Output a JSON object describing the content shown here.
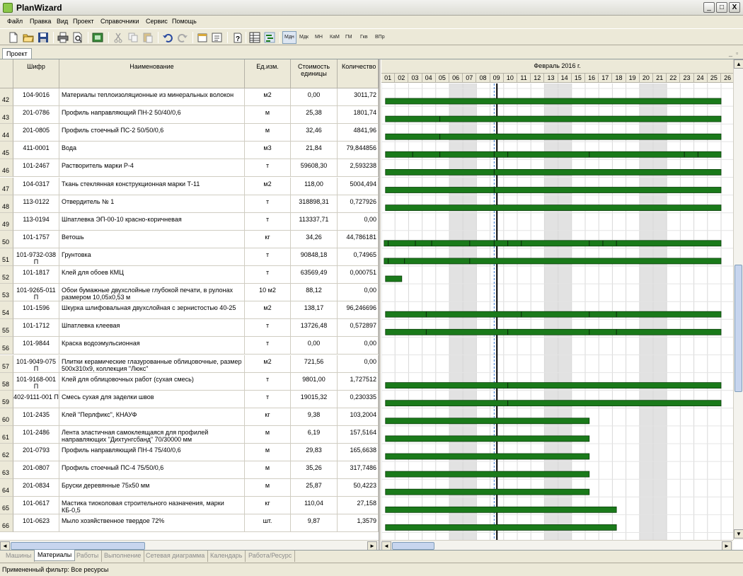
{
  "window": {
    "title": "PlanWizard",
    "controls": [
      "_",
      "□",
      "X"
    ]
  },
  "menu": [
    "Файл",
    "Правка",
    "Вид",
    "Проект",
    "Справочники",
    "Сервис",
    "Помощь"
  ],
  "toolbar": {
    "scale_buttons": [
      "Мдн",
      "Мдк",
      "МН",
      "КаМ",
      "ГМ",
      "Гкв",
      "ВПр"
    ]
  },
  "doc_tab": "Проект",
  "table": {
    "columns": {
      "code": "Шифр",
      "name": "Наименование",
      "unit": "Ед.изм.",
      "cost": "Стоимость единицы",
      "qty": "Количество"
    },
    "rows": [
      {
        "num": "42",
        "code": "104-9016",
        "name": "Материалы теплоизоляционные из минеральных волокон",
        "unit": "м2",
        "cost": "0,00",
        "qty": "3011,72"
      },
      {
        "num": "43",
        "code": "201-0786",
        "name": "Профиль направляющий ПН-2 50/40/0,6",
        "unit": "м",
        "cost": "25,38",
        "qty": "1801,74"
      },
      {
        "num": "44",
        "code": "201-0805",
        "name": "Профиль стоечный ПС-2 50/50/0,6",
        "unit": "м",
        "cost": "32,46",
        "qty": "4841,96"
      },
      {
        "num": "45",
        "code": "411-0001",
        "name": "Вода",
        "unit": "м3",
        "cost": "21,84",
        "qty": "79,844856"
      },
      {
        "num": "46",
        "code": "101-2467",
        "name": "Растворитель марки Р-4",
        "unit": "т",
        "cost": "59608,30",
        "qty": "2,593238"
      },
      {
        "num": "47",
        "code": "104-0317",
        "name": "Ткань стеклянная конструкционная марки Т-11",
        "unit": "м2",
        "cost": "118,00",
        "qty": "5004,494"
      },
      {
        "num": "48",
        "code": "113-0122",
        "name": "Отвердитель № 1",
        "unit": "т",
        "cost": "318898,31",
        "qty": "0,727926"
      },
      {
        "num": "49",
        "code": "113-0194",
        "name": "Шпатлевка ЭП-00-10 красно-коричневая",
        "unit": "т",
        "cost": "113337,71",
        "qty": "0,00"
      },
      {
        "num": "50",
        "code": "101-1757",
        "name": "Ветошь",
        "unit": "кг",
        "cost": "34,26",
        "qty": "44,786181"
      },
      {
        "num": "51",
        "code": "101-9732-038 П",
        "name": "Грунтовка",
        "unit": "т",
        "cost": "90848,18",
        "qty": "0,74965"
      },
      {
        "num": "52",
        "code": "101-1817",
        "name": "Клей для обоев КМЦ",
        "unit": "т",
        "cost": "63569,49",
        "qty": "0,000751"
      },
      {
        "num": "53",
        "code": "101-9265-011 П",
        "name": "Обои бумажные двухслойные глубокой печати, в рулонах размером 10,05х0,53 м",
        "unit": "10 м2",
        "cost": "88,12",
        "qty": "0,00"
      },
      {
        "num": "54",
        "code": "101-1596",
        "name": "Шкурка шлифовальная двухслойная с зернистостью 40-25",
        "unit": "м2",
        "cost": "138,17",
        "qty": "96,246696"
      },
      {
        "num": "55",
        "code": "101-1712",
        "name": "Шпатлевка клеевая",
        "unit": "т",
        "cost": "13726,48",
        "qty": "0,572897"
      },
      {
        "num": "56",
        "code": "101-9844",
        "name": "Краска водоэмульсионная",
        "unit": "т",
        "cost": "0,00",
        "qty": "0,00"
      },
      {
        "num": "57",
        "code": "101-9049-075 П",
        "name": "Плитки керамические глазурованные облицовочные, размер 500х310х9, коллекция \"Люкс\"",
        "unit": "м2",
        "cost": "721,56",
        "qty": "0,00"
      },
      {
        "num": "58",
        "code": "101-9168-001 П",
        "name": "Клей для облицовочных работ (сухая смесь)",
        "unit": "т",
        "cost": "9801,00",
        "qty": "1,727512"
      },
      {
        "num": "59",
        "code": "402-9111-001 П",
        "name": "Смесь сухая для заделки швов",
        "unit": "т",
        "cost": "19015,32",
        "qty": "0,230335"
      },
      {
        "num": "60",
        "code": "101-2435",
        "name": "Клей \"Перлфикс\", КНАУФ",
        "unit": "кг",
        "cost": "9,38",
        "qty": "103,2004"
      },
      {
        "num": "61",
        "code": "101-2486",
        "name": "Лента эластичная самоклеящаяся для профилей направляющих \"Дихтунгсбанд\" 70/30000 мм",
        "unit": "м",
        "cost": "6,19",
        "qty": "157,5164"
      },
      {
        "num": "62",
        "code": "201-0793",
        "name": "Профиль направляющий ПН-4 75/40/0,6",
        "unit": "м",
        "cost": "29,83",
        "qty": "165,6638"
      },
      {
        "num": "63",
        "code": "201-0807",
        "name": "Профиль стоечный ПС-4 75/50/0,6",
        "unit": "м",
        "cost": "35,26",
        "qty": "317,7486"
      },
      {
        "num": "64",
        "code": "201-0834",
        "name": "Бруски деревянные 75х50 мм",
        "unit": "м",
        "cost": "25,87",
        "qty": "50,4223"
      },
      {
        "num": "65",
        "code": "101-0617",
        "name": "Мастика тиоколовая строительного назначения, марки КБ-0,5",
        "unit": "кг",
        "cost": "110,04",
        "qty": "27,158"
      },
      {
        "num": "66",
        "code": "101-0623",
        "name": "Мыло хозяйственное твердое 72%",
        "unit": "шт.",
        "cost": "9,87",
        "qty": "1,3579"
      }
    ]
  },
  "gantt": {
    "month": "Февраль 2016 г.",
    "days": [
      "01",
      "02",
      "03",
      "04",
      "05",
      "06",
      "07",
      "08",
      "09",
      "10",
      "11",
      "12",
      "13",
      "14",
      "15",
      "16",
      "17",
      "18",
      "19",
      "20",
      "21",
      "22",
      "23",
      "24",
      "25",
      "26"
    ],
    "weekend_days": [
      6,
      7,
      13,
      14,
      20,
      21
    ],
    "today_day": 9.5,
    "current_day": 9.3,
    "bar_color": "#1a7a1a",
    "bars": [
      {
        "row": 0,
        "start": 1.3,
        "end": 26.0,
        "marks": []
      },
      {
        "row": 1,
        "start": 1.3,
        "end": 26.0,
        "marks": [
          5.3
        ]
      },
      {
        "row": 2,
        "start": 1.3,
        "end": 26.0,
        "marks": [
          5.3
        ]
      },
      {
        "row": 3,
        "start": 1.3,
        "end": 26.0,
        "marks": [
          3.3,
          5.3,
          9.3,
          10.3,
          16.3,
          23.3,
          24.3
        ]
      },
      {
        "row": 4,
        "start": 1.3,
        "end": 26.0,
        "marks": [
          9.3
        ]
      },
      {
        "row": 5,
        "start": 1.3,
        "end": 26.0,
        "marks": [
          9.3
        ]
      },
      {
        "row": 6,
        "start": 1.3,
        "end": 26.0,
        "marks": []
      },
      {
        "row": 8,
        "start": 1.2,
        "end": 26.0,
        "marks": [
          1.5,
          3.5,
          4.7,
          7.5,
          9.3,
          10.3,
          11.3,
          16.3,
          17.3,
          18.3
        ]
      },
      {
        "row": 9,
        "start": 1.2,
        "end": 26.0,
        "marks": [
          1.5,
          2.7,
          7.5
        ]
      },
      {
        "row": 10,
        "start": 1.3,
        "end": 2.5,
        "marks": []
      },
      {
        "row": 12,
        "start": 1.3,
        "end": 26.0,
        "marks": [
          4.3,
          11.3,
          16.3,
          18.3
        ]
      },
      {
        "row": 13,
        "start": 1.3,
        "end": 26.0,
        "marks": [
          4.3,
          10.3,
          16.3,
          18.3
        ]
      },
      {
        "row": 16,
        "start": 1.3,
        "end": 26.0,
        "marks": [
          10.3
        ]
      },
      {
        "row": 17,
        "start": 1.3,
        "end": 26.0,
        "marks": [
          10.3
        ]
      },
      {
        "row": 18,
        "start": 1.3,
        "end": 16.3,
        "marks": []
      },
      {
        "row": 19,
        "start": 1.3,
        "end": 16.3,
        "marks": []
      },
      {
        "row": 20,
        "start": 1.3,
        "end": 16.3,
        "marks": []
      },
      {
        "row": 21,
        "start": 1.3,
        "end": 16.3,
        "marks": []
      },
      {
        "row": 22,
        "start": 1.3,
        "end": 16.3,
        "marks": []
      },
      {
        "row": 23,
        "start": 1.3,
        "end": 18.3,
        "marks": []
      },
      {
        "row": 24,
        "start": 1.3,
        "end": 18.3,
        "marks": []
      }
    ]
  },
  "sheet_tabs": [
    "Машины",
    "Материалы",
    "Работы",
    "Выполнение",
    "Сетевая диаграмма",
    "Календарь",
    "Работа/Ресурс"
  ],
  "active_sheet": 1,
  "status": "Примененный фильтр: Все ресурсы"
}
